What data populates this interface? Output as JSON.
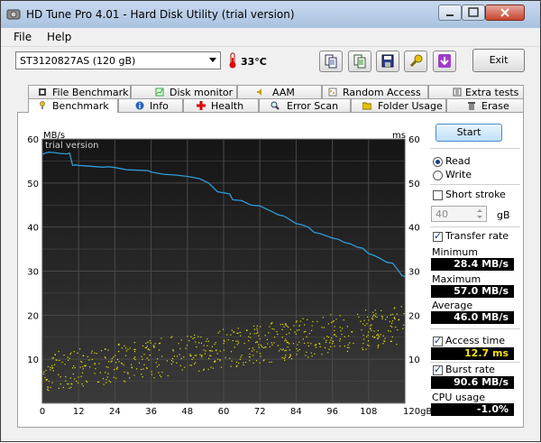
{
  "window": {
    "title": "HD Tune Pro 4.01 - Hard Disk Utility (trial version)"
  },
  "menu": {
    "items": [
      {
        "label": "File"
      },
      {
        "label": "Help"
      }
    ]
  },
  "toolbar": {
    "drive": "ST3120827AS (120 gB)",
    "temperature": "33°C",
    "exit_label": "Exit"
  },
  "tabs": {
    "row1": [
      {
        "label": "File Benchmark",
        "icon": "file-benchmark-icon"
      },
      {
        "label": "Disk monitor",
        "icon": "disk-monitor-icon"
      },
      {
        "label": "AAM",
        "icon": "speaker-icon"
      },
      {
        "label": "Random Access",
        "icon": "random-access-icon"
      },
      {
        "label": "Extra tests",
        "icon": "extra-tests-icon"
      }
    ],
    "row2": [
      {
        "label": "Benchmark",
        "icon": "benchmark-icon"
      },
      {
        "label": "Info",
        "icon": "info-icon"
      },
      {
        "label": "Health",
        "icon": "health-icon"
      },
      {
        "label": "Error Scan",
        "icon": "magnifier-icon"
      },
      {
        "label": "Folder Usage",
        "icon": "folder-icon"
      },
      {
        "label": "Erase",
        "icon": "trash-icon"
      }
    ]
  },
  "side": {
    "start_label": "Start",
    "read_label": "Read",
    "write_label": "Write",
    "short_stroke_label": "Short stroke",
    "short_stroke_value": "40",
    "short_stroke_unit": "gB",
    "transfer_rate_label": "Transfer rate",
    "minimum_label": "Minimum",
    "minimum_value": "28.4 MB/s",
    "maximum_label": "Maximum",
    "maximum_value": "57.0 MB/s",
    "average_label": "Average",
    "average_value": "46.0 MB/s",
    "access_time_label": "Access time",
    "access_time_value": "12.7 ms",
    "burst_rate_label": "Burst rate",
    "burst_rate_value": "90.6 MB/s",
    "cpu_usage_label": "CPU usage",
    "cpu_usage_value": "-1.0%",
    "read_selected": true,
    "short_stroke_checked": false,
    "transfer_rate_checked": true,
    "access_time_checked": true,
    "burst_rate_checked": true
  },
  "chart_data": {
    "type": "line",
    "watermark": "trial version",
    "ylabel_left": "MB/s",
    "ylabel_right": "ms",
    "xunit": "gB",
    "xlim": [
      0,
      120
    ],
    "ylim": [
      0,
      60
    ],
    "x_ticks": [
      0,
      12,
      24,
      36,
      48,
      60,
      72,
      84,
      96,
      108,
      120
    ],
    "x_tick_labels": [
      "0",
      "12",
      "24",
      "36",
      "48",
      "60",
      "72",
      "84",
      "96",
      "108",
      "120gB"
    ],
    "y_ticks": [
      10,
      20,
      30,
      40,
      50,
      60
    ],
    "y_tick_labels_left": [
      "10",
      "20",
      "30",
      "40",
      "50",
      "60"
    ],
    "y_tick_labels_right": [
      "10",
      "20",
      "30",
      "40",
      "50",
      "60"
    ],
    "grid": true,
    "colors": {
      "transfer": "#2f9bd8",
      "access": "#e8e000",
      "grid": "#4a4a4a",
      "background": "#1c1c1c"
    },
    "series": [
      {
        "values_x": [
          0,
          1,
          2,
          4,
          6,
          8,
          9,
          10,
          11,
          12,
          16,
          20,
          22,
          24,
          28,
          32,
          35,
          36,
          40,
          44,
          48,
          52,
          55,
          58,
          60,
          62,
          63,
          66,
          69,
          72,
          76,
          78,
          80,
          84,
          86,
          88,
          90,
          92,
          96,
          98,
          100,
          102,
          104,
          106,
          108,
          110,
          112,
          114,
          116,
          118,
          119,
          120
        ],
        "values_y": [
          56.5,
          56.8,
          57.0,
          56.9,
          56.7,
          56.6,
          56.8,
          54.0,
          54.1,
          54.0,
          53.8,
          53.6,
          53.7,
          53.5,
          53.0,
          52.9,
          52.8,
          52.5,
          52.0,
          51.8,
          51.5,
          51.0,
          50.0,
          48.0,
          47.8,
          47.5,
          46.2,
          46.0,
          45.0,
          44.8,
          43.5,
          42.8,
          42.5,
          40.8,
          40.5,
          40.0,
          38.8,
          38.5,
          37.5,
          37.2,
          36.5,
          36.2,
          35.5,
          35.2,
          34.0,
          33.5,
          32.8,
          32.0,
          31.8,
          30.0,
          29.0,
          28.8
        ]
      }
    ],
    "access_time_scatter": {
      "x_range": [
        0,
        120
      ],
      "ms_min": 2,
      "ms_max": 23,
      "count": 620
    }
  }
}
